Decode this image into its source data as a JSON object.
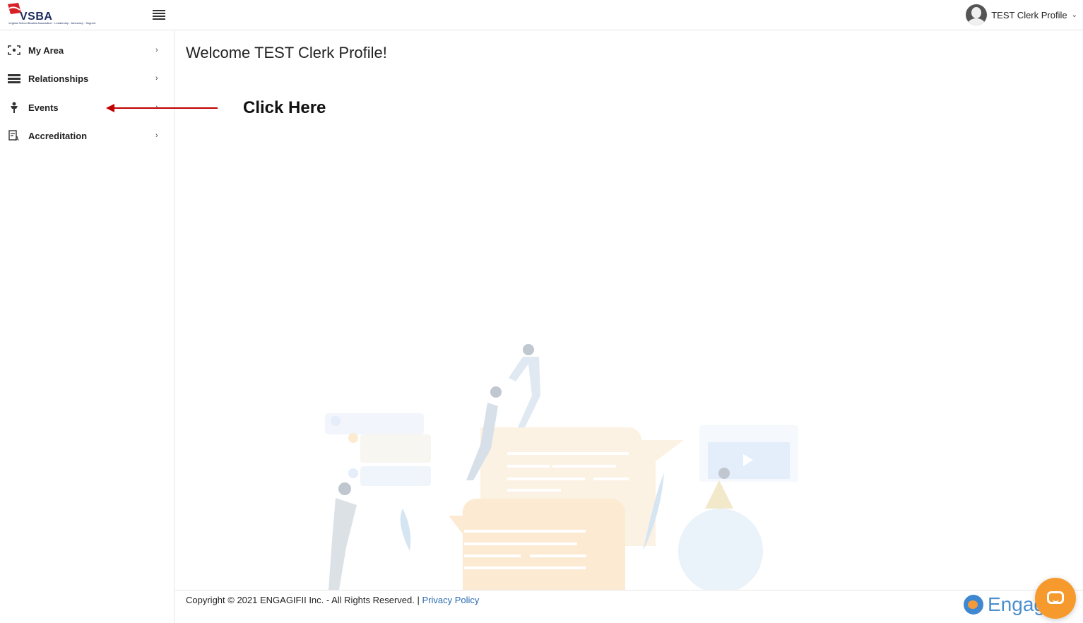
{
  "header": {
    "logo_text": "VSBA",
    "logo_subtext": "Virginia School Boards Association · Leadership · Advocacy · Support",
    "profile_name": "TEST Clerk Profile"
  },
  "sidebar": {
    "items": [
      {
        "label": "My Area",
        "icon": "my-area-icon"
      },
      {
        "label": "Relationships",
        "icon": "relationships-icon"
      },
      {
        "label": "Events",
        "icon": "events-icon"
      },
      {
        "label": "Accreditation",
        "icon": "accreditation-icon"
      }
    ]
  },
  "main": {
    "welcome": "Welcome TEST Clerk Profile!",
    "annotation": "Click Here"
  },
  "footer": {
    "copyright": "Copyright © 2021 ENGAGIFII Inc. - All Rights Reserved. | ",
    "privacy": "Privacy Policy",
    "brand": "Engag"
  },
  "colors": {
    "accent": "#2a6bb0",
    "arrow": "#c00000",
    "chat": "#f79a2d"
  }
}
